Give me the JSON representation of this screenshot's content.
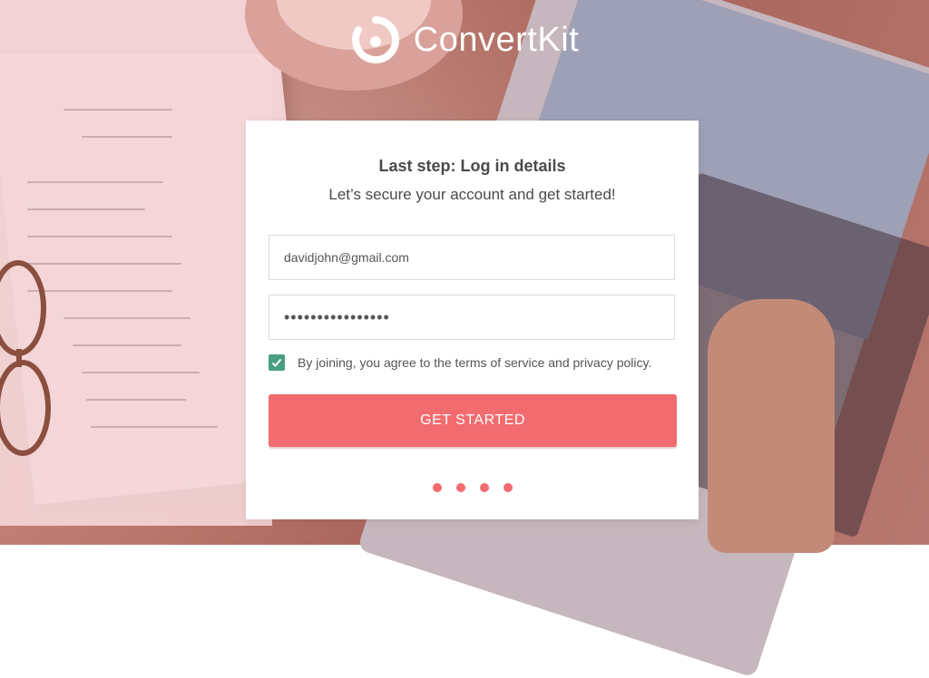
{
  "brand": {
    "name": "ConvertKit",
    "logo_icon": "convertkit-logo-icon"
  },
  "card": {
    "title": "Last step: Log in details",
    "subtitle": "Let’s secure your account and get started!",
    "email_value": "davidjohn@gmail.com",
    "password_masked": "••••••••••••••••",
    "agree_checked": true,
    "agree_text": "By joining, you agree to the terms of service and privacy policy.",
    "cta_label": "GET STARTED",
    "steps_total": 4
  },
  "colors": {
    "accent": "#f26b6f",
    "checkbox": "#4a9e83",
    "text": "#4a4a4a"
  }
}
